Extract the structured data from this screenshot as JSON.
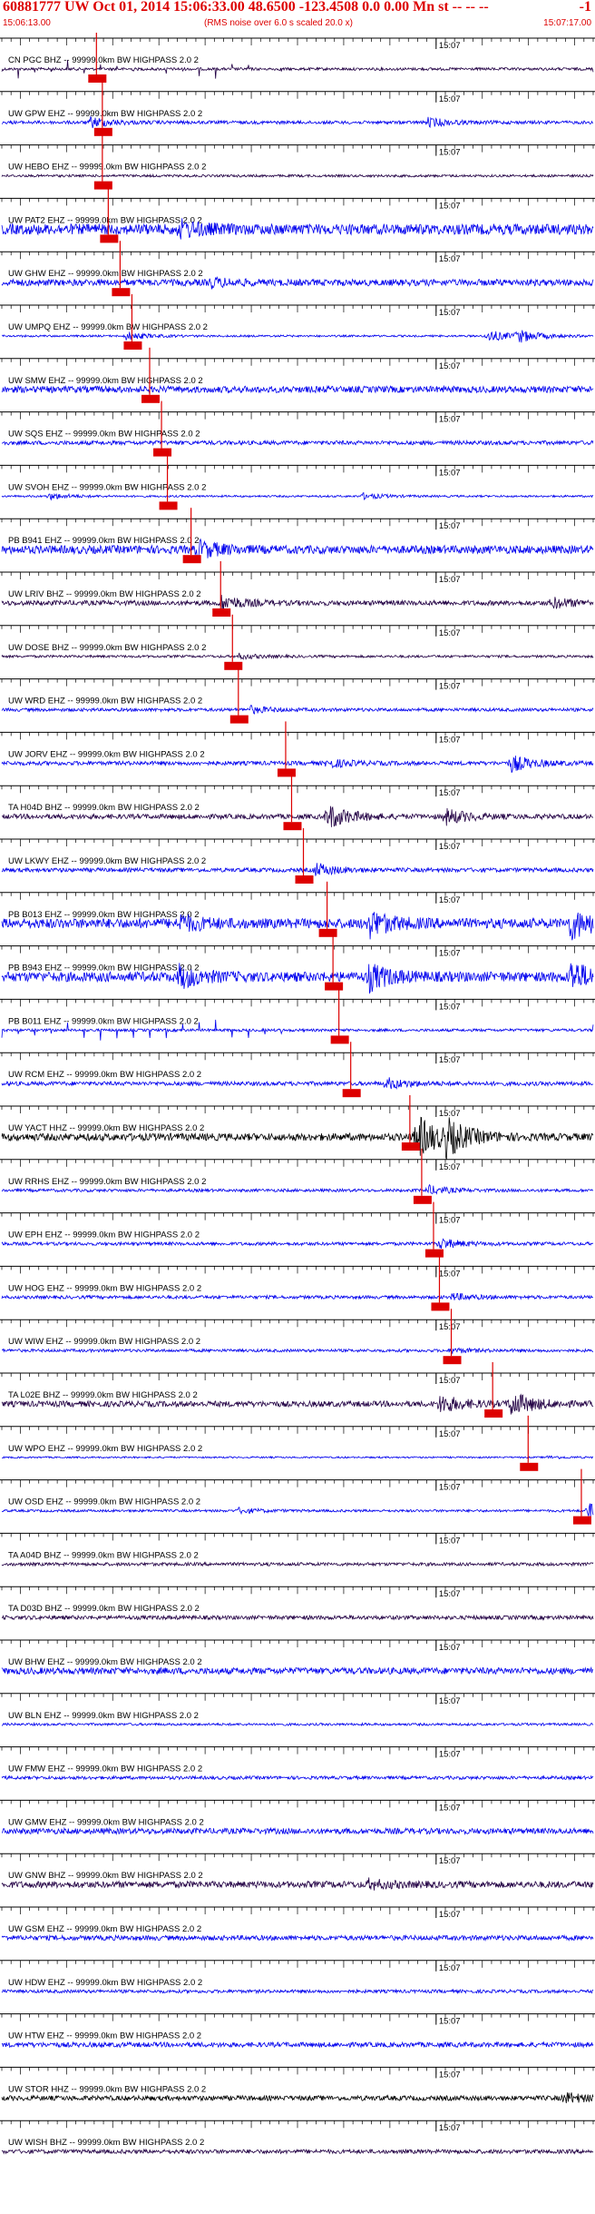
{
  "header": {
    "title": "60881777 UW Oct 01, 2014 15:06:33.00   48.6500 -123.4508  0.0 0.00 Mn st -- -- --",
    "title_tail": "-1",
    "start_time": "15:06:13.00",
    "note": "(RMS noise over 6.0 s scaled 20.0 x)",
    "end_time": "15:07:17.00"
  },
  "chart_data": {
    "type": "seismogram",
    "x_start": "15:06:13.00",
    "x_end": "15:07:17.00",
    "minute_mark_label": "15:07",
    "colors": {
      "trace_blue": "#0000ee",
      "trace_dark": "#220044",
      "trace_black": "#000000",
      "pick": "#dd0000",
      "axis": "#000000"
    },
    "traces": [
      {
        "label": "CN PGC BHZ -- 99999.0km BW  HIGHPASS  2.0  2",
        "color": "#220044",
        "amp": 0.3,
        "events": [
          {
            "t": 0.0,
            "a": 1.0
          },
          {
            "t": 0.69,
            "a": 0.6
          }
        ],
        "style": "spikes",
        "pick": 0.16
      },
      {
        "label": "UW GPW EHZ -- 99999.0km BW  HIGHPASS  2.0  2",
        "color": "#0000ee",
        "amp": 0.2,
        "events": [
          {
            "t": 0.15,
            "a": 3.0
          },
          {
            "t": 0.72,
            "a": 2.5
          }
        ],
        "pick": 0.17
      },
      {
        "label": "UW HEBO EHZ -- 99999.0km BW  HIGHPASS  2.0  2",
        "color": "#220044",
        "amp": 0.15,
        "events": [],
        "pick": 0.17
      },
      {
        "label": "UW PAT2 EHZ -- 99999.0km BW  HIGHPASS  2.0  2",
        "color": "#0000ee",
        "amp": 0.65,
        "events": [
          {
            "t": 0.3,
            "a": 1.3
          }
        ],
        "pick": 0.18
      },
      {
        "label": "UW GHW EHZ -- 99999.0km BW  HIGHPASS  2.0  2",
        "color": "#0000ee",
        "amp": 0.4,
        "events": [
          {
            "t": 0.35,
            "a": 1.2
          }
        ],
        "pick": 0.2
      },
      {
        "label": "UW UMPQ EHZ -- 99999.0km BW  HIGHPASS  2.0  2",
        "color": "#0000ee",
        "amp": 0.12,
        "events": [
          {
            "t": 0.21,
            "a": 4.0
          },
          {
            "t": 0.82,
            "a": 6.0
          },
          {
            "t": 0.87,
            "a": 6.0
          }
        ],
        "pick": 0.22
      },
      {
        "label": "UW SMW EHZ -- 99999.0km BW  HIGHPASS  2.0  2",
        "color": "#0000ee",
        "amp": 0.4,
        "events": [],
        "pick": 0.25
      },
      {
        "label": "UW SQS EHZ -- 99999.0km BW  HIGHPASS  2.0  2",
        "color": "#0000ee",
        "amp": 0.25,
        "events": [],
        "pick": 0.27
      },
      {
        "label": "UW SVOH EHZ -- 99999.0km BW  HIGHPASS  2.0  2",
        "color": "#0000ee",
        "amp": 0.12,
        "events": [
          {
            "t": 0.08,
            "a": 3.0
          },
          {
            "t": 0.61,
            "a": 3.0
          }
        ],
        "pick": 0.28
      },
      {
        "label": "PB B941 EHZ -- 99999.0km BW  HIGHPASS  2.0  2",
        "color": "#0000ee",
        "amp": 0.5,
        "events": [
          {
            "t": 0.33,
            "a": 2.0
          }
        ],
        "pick": 0.32
      },
      {
        "label": "UW LRIV BHZ -- 99999.0km BW  HIGHPASS  2.0  2",
        "color": "#220044",
        "amp": 0.3,
        "events": [
          {
            "t": 0.37,
            "a": 3.0
          },
          {
            "t": 0.93,
            "a": 2.0
          }
        ],
        "pick": 0.37
      },
      {
        "label": "UW DOSE BHZ -- 99999.0km BW  HIGHPASS  2.0  2",
        "color": "#220044",
        "amp": 0.15,
        "events": [
          {
            "t": 0.4,
            "a": 2.0
          }
        ],
        "pick": 0.39
      },
      {
        "label": "UW WRD EHZ -- 99999.0km BW  HIGHPASS  2.0  2",
        "color": "#0000ee",
        "amp": 0.2,
        "events": [
          {
            "t": 0.42,
            "a": 2.0
          }
        ],
        "pick": 0.4
      },
      {
        "label": "UW JORV EHZ -- 99999.0km BW  HIGHPASS  2.0  2",
        "color": "#0000ee",
        "amp": 0.25,
        "events": [
          {
            "t": 0.55,
            "a": 2.0
          },
          {
            "t": 0.86,
            "a": 4.0
          }
        ],
        "pick": 0.48
      },
      {
        "label": "TA H04D BHZ -- 99999.0km BW  HIGHPASS  2.0  2",
        "color": "#220044",
        "amp": 0.3,
        "events": [
          {
            "t": 0.55,
            "a": 5.0
          },
          {
            "t": 0.75,
            "a": 3.0
          }
        ],
        "pick": 0.49
      },
      {
        "label": "UW LKWY EHZ -- 99999.0km BW  HIGHPASS  2.0  2",
        "color": "#0000ee",
        "amp": 0.25,
        "events": [
          {
            "t": 0.53,
            "a": 3.0
          }
        ],
        "pick": 0.51
      },
      {
        "label": "PB B013 EHZ -- 99999.0km BW  HIGHPASS  2.0  2",
        "color": "#0000ee",
        "amp": 0.6,
        "events": [
          {
            "t": 0.3,
            "a": 1.5
          },
          {
            "t": 0.62,
            "a": 2.5
          },
          {
            "t": 0.96,
            "a": 3.0
          }
        ],
        "pick": 0.55
      },
      {
        "label": "PB B943 EHZ -- 99999.0km BW  HIGHPASS  2.0  2",
        "color": "#0000ee",
        "amp": 0.6,
        "events": [
          {
            "t": 0.3,
            "a": 2.0
          },
          {
            "t": 0.62,
            "a": 2.5
          },
          {
            "t": 0.96,
            "a": 3.0
          }
        ],
        "pick": 0.56
      },
      {
        "label": "PB B011 EHZ -- 99999.0km BW  HIGHPASS  2.0  2",
        "color": "#0000ee",
        "amp": 0.15,
        "events": [
          {
            "t": 0.58,
            "a": 2.0
          }
        ],
        "style": "spikes",
        "pick": 0.57
      },
      {
        "label": "UW RCM EHZ -- 99999.0km BW  HIGHPASS  2.0  2",
        "color": "#0000ee",
        "amp": 0.25,
        "events": [
          {
            "t": 0.65,
            "a": 2.5
          }
        ],
        "pick": 0.59
      },
      {
        "label": "UW YACT HHZ -- 99999.0km BW  HIGHPASS  2.0  2",
        "color": "#000000",
        "amp": 0.45,
        "events": [
          {
            "t": 0.7,
            "a": 6.0
          },
          {
            "t": 0.75,
            "a": 4.0
          }
        ],
        "pick": 0.69
      },
      {
        "label": "UW RRHS EHZ -- 99999.0km BW  HIGHPASS  2.0  2",
        "color": "#0000ee",
        "amp": 0.18,
        "events": [
          {
            "t": 0.72,
            "a": 3.0
          }
        ],
        "pick": 0.71
      },
      {
        "label": "UW EPH EHZ -- 99999.0km BW  HIGHPASS  2.0  2",
        "color": "#0000ee",
        "amp": 0.2,
        "events": [
          {
            "t": 0.74,
            "a": 3.0
          }
        ],
        "pick": 0.73
      },
      {
        "label": "UW HOG EHZ -- 99999.0km BW  HIGHPASS  2.0  2",
        "color": "#0000ee",
        "amp": 0.2,
        "events": [
          {
            "t": 0.76,
            "a": 2.0
          }
        ],
        "pick": 0.74
      },
      {
        "label": "UW WIW EHZ -- 99999.0km BW  HIGHPASS  2.0  2",
        "color": "#0000ee",
        "amp": 0.18,
        "events": [
          {
            "t": 0.76,
            "a": 1.5
          }
        ],
        "pick": 0.76
      },
      {
        "label": "TA L02E BHZ -- 99999.0km BW  HIGHPASS  2.0  2",
        "color": "#220044",
        "amp": 0.35,
        "events": [
          {
            "t": 0.74,
            "a": 3.0
          },
          {
            "t": 0.86,
            "a": 4.0
          }
        ],
        "pick": 0.83
      },
      {
        "label": "UW WPO EHZ -- 99999.0km BW  HIGHPASS  2.0  2",
        "color": "#0000ee",
        "amp": 0.1,
        "events": [
          {
            "t": 0.92,
            "a": 1.5
          }
        ],
        "pick": 0.89
      },
      {
        "label": "UW OSD EHZ -- 99999.0km BW  HIGHPASS  2.0  2",
        "color": "#0000ee",
        "amp": 0.15,
        "events": [
          {
            "t": 0.4,
            "a": 2.0
          },
          {
            "t": 0.99,
            "a": 6.0
          }
        ],
        "pick": 0.98
      },
      {
        "label": "TA A04D BHZ -- 99999.0km BW  HIGHPASS  2.0  2",
        "color": "#220044",
        "amp": 0.2,
        "events": []
      },
      {
        "label": "TA D03D BHZ -- 99999.0km BW  HIGHPASS  2.0  2",
        "color": "#220044",
        "amp": 0.25,
        "events": []
      },
      {
        "label": "UW BHW EHZ -- 99999.0km BW  HIGHPASS  2.0  2",
        "color": "#0000ee",
        "amp": 0.4,
        "events": []
      },
      {
        "label": "UW BLN EHZ -- 99999.0km BW  HIGHPASS  2.0  2",
        "color": "#0000ee",
        "amp": 0.15,
        "events": []
      },
      {
        "label": "UW FMW EHZ -- 99999.0km BW  HIGHPASS  2.0  2",
        "color": "#0000ee",
        "amp": 0.2,
        "events": []
      },
      {
        "label": "UW GMW EHZ -- 99999.0km BW  HIGHPASS  2.0  2",
        "color": "#0000ee",
        "amp": 0.35,
        "events": []
      },
      {
        "label": "UW GNW BHZ -- 99999.0km BW  HIGHPASS  2.0  2",
        "color": "#220044",
        "amp": 0.4,
        "events": [
          {
            "t": 0.62,
            "a": 1.2
          }
        ]
      },
      {
        "label": "UW GSM EHZ -- 99999.0km BW  HIGHPASS  2.0  2",
        "color": "#0000ee",
        "amp": 0.3,
        "events": []
      },
      {
        "label": "UW HDW EHZ -- 99999.0km BW  HIGHPASS  2.0  2",
        "color": "#0000ee",
        "amp": 0.2,
        "events": []
      },
      {
        "label": "UW HTW EHZ -- 99999.0km BW  HIGHPASS  2.0  2",
        "color": "#0000ee",
        "amp": 0.3,
        "events": []
      },
      {
        "label": "UW STOR HHZ -- 99999.0km BW  HIGHPASS  2.0  2",
        "color": "#000000",
        "amp": 0.3,
        "events": [
          {
            "t": 0.95,
            "a": 2.0
          }
        ]
      },
      {
        "label": "UW WISH BHZ -- 99999.0km BW  HIGHPASS  2.0  2",
        "color": "#220044",
        "amp": 0.25,
        "events": []
      }
    ]
  }
}
